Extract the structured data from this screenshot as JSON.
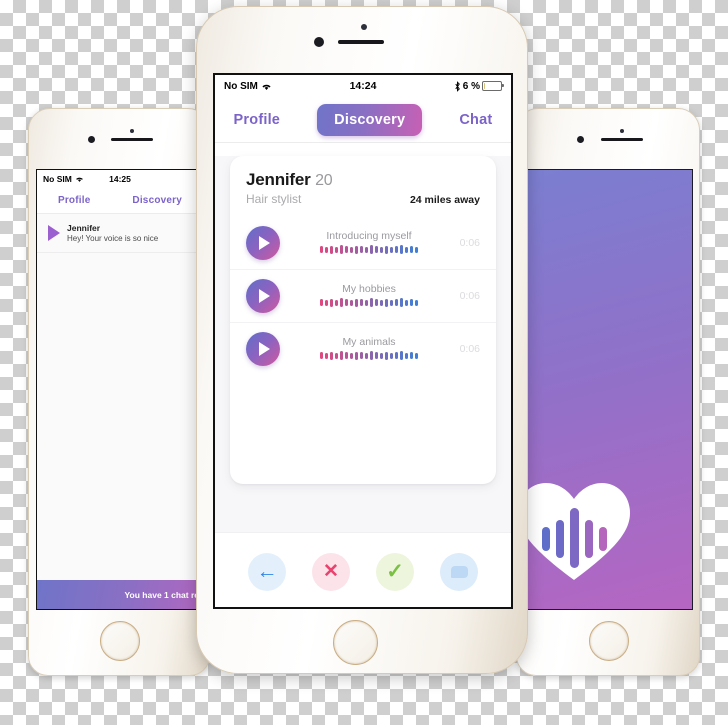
{
  "center_phone": {
    "status_bar": {
      "carrier": "No SIM",
      "wifi_icon": "wifi-icon",
      "time": "14:24",
      "bluetooth_icon": "bluetooth-icon",
      "battery_percent": "6 %"
    },
    "tabs": [
      {
        "label": "Profile",
        "active": false
      },
      {
        "label": "Discovery",
        "active": true
      },
      {
        "label": "Chat",
        "active": false
      }
    ],
    "profile": {
      "name": "Jennifer",
      "age": "20",
      "occupation": "Hair stylist",
      "distance": "24 miles away",
      "clips": [
        {
          "title": "Introducing myself",
          "duration": "0:06",
          "play_icon": "play-icon"
        },
        {
          "title": "My hobbies",
          "duration": "0:06",
          "play_icon": "play-icon"
        },
        {
          "title": "My animals",
          "duration": "0:06",
          "play_icon": "play-icon"
        }
      ]
    },
    "actions": [
      {
        "name": "rewind",
        "icon": "arrow-left-icon",
        "glyph": "←",
        "color": "#2f86e8"
      },
      {
        "name": "reject",
        "icon": "close-x-icon",
        "glyph": "✕",
        "color": "#e8436f"
      },
      {
        "name": "accept",
        "icon": "checkmark-icon",
        "glyph": "✓",
        "color": "#7ac143"
      },
      {
        "name": "chat",
        "icon": "chat-bubble-icon",
        "glyph": "",
        "color": "#bcd8f4"
      }
    ]
  },
  "left_phone": {
    "status_bar": {
      "carrier": "No SIM",
      "time": "14:25"
    },
    "tabs": [
      {
        "label": "Profile"
      },
      {
        "label": "Discovery"
      }
    ],
    "chat_item": {
      "name": "Jennifer",
      "message": "Hey! Your voice is so nice",
      "play_icon": "play-icon"
    },
    "banner": {
      "text": "You have 1 chat re"
    }
  },
  "right_phone": {
    "splash": {
      "logo_icon": "heart-waveform-logo"
    }
  },
  "colors": {
    "accent_purple": "#7b63c9",
    "gradient_start": "#6f74c8",
    "gradient_end": "#c860b4",
    "wave_start": "#e0467f",
    "wave_end": "#3f7fd8"
  }
}
